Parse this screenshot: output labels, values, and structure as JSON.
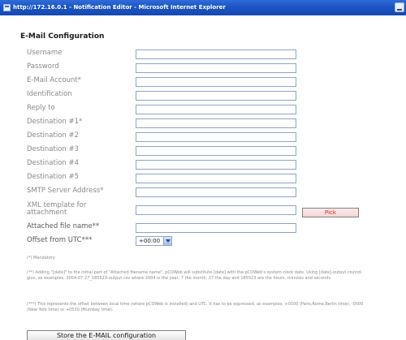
{
  "window": {
    "title": "http://172.16.0.1 - Notification Editor - Microsoft Internet Explorer"
  },
  "form": {
    "heading": "E-Mail Configuration",
    "fields": [
      {
        "label": "Username",
        "value": ""
      },
      {
        "label": "Password",
        "value": ""
      },
      {
        "label": "E-Mail Account*",
        "value": ""
      },
      {
        "label": "Identification",
        "value": ""
      },
      {
        "label": "Reply to",
        "value": ""
      },
      {
        "label": "Destination #1*",
        "value": ""
      },
      {
        "label": "Destination #2",
        "value": ""
      },
      {
        "label": "Destination #3",
        "value": ""
      },
      {
        "label": "Destination #4",
        "value": ""
      },
      {
        "label": "Destination #5",
        "value": ""
      },
      {
        "label": "SMTP Server Address*",
        "value": ""
      }
    ],
    "xml_template": {
      "label_line1": "XML template for",
      "label_line2": "attachment",
      "value": ""
    },
    "pick_label": "Pick",
    "attached_filename": {
      "label": "Attached file name**",
      "value": ""
    },
    "utc_offset": {
      "label": "Offset from UTC***",
      "selected": "+00:00"
    }
  },
  "notes": {
    "mandatory": "(*) Mandatory",
    "filename_note": "(**) Adding \"[date]\" to the initial part of \"Attached filename name\", pCOWeb will substitute [date] with the pCOWeb's system clock date. Using [date]-output.csv\\nd-glov, as examples, 2004-07-27_185523-output.csv where 2004 is the year, 7 the month, 27 the day and 185523 are the hours, minutes and seconds.",
    "offset_note": "(***) This represents the offset between local time (where pCOWeb is installed) and UTC. It has to be expressed, as examples, +0100 (Paris,Rome,Berlin time), -0500 (New York time) or +0530 (Mumbay time)."
  },
  "store_button_label": "Store the E-MAIL configuration"
}
